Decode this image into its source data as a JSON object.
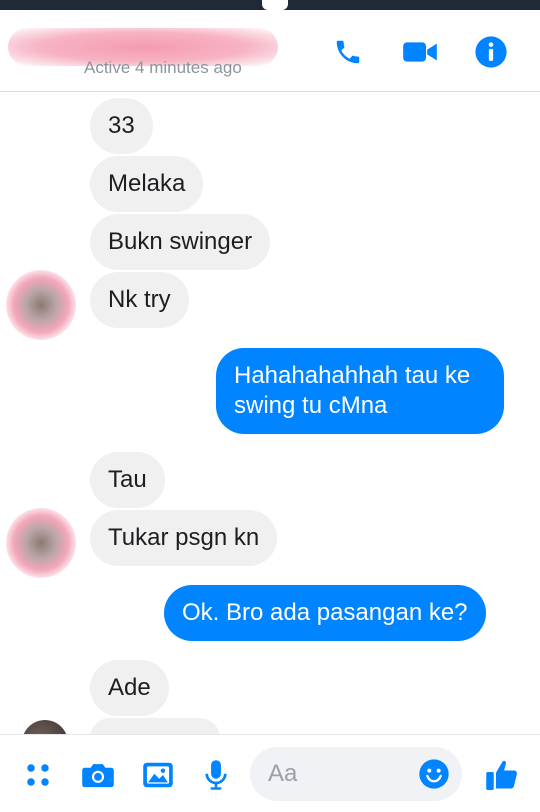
{
  "header": {
    "status": "Active 4 minutes ago",
    "call_icon": "phone-icon",
    "video_icon": "video-camera-icon",
    "info_icon": "info-icon"
  },
  "messages": [
    {
      "side": "in",
      "text": "33"
    },
    {
      "side": "in",
      "text": "Melaka"
    },
    {
      "side": "in",
      "text": "Bukn swinger"
    },
    {
      "side": "in",
      "text": "Nk try"
    },
    {
      "side": "out",
      "text": "Hahahahahhah tau ke swing tu cMna"
    },
    {
      "side": "in",
      "text": "Tau"
    },
    {
      "side": "in",
      "text": "Tukar psgn kn"
    },
    {
      "side": "out",
      "text": "Ok. Bro ada pasangan ke?"
    },
    {
      "side": "in",
      "text": "Ade"
    }
  ],
  "composer": {
    "placeholder": "Aa",
    "icons": [
      "more-apps-icon",
      "camera-icon",
      "gallery-icon",
      "microphone-icon",
      "emoji-icon",
      "thumbs-up-icon"
    ]
  },
  "colors": {
    "accent": "#0084ff",
    "incoming_bubble": "#f0f0f0",
    "muted_text": "#8d949e"
  }
}
